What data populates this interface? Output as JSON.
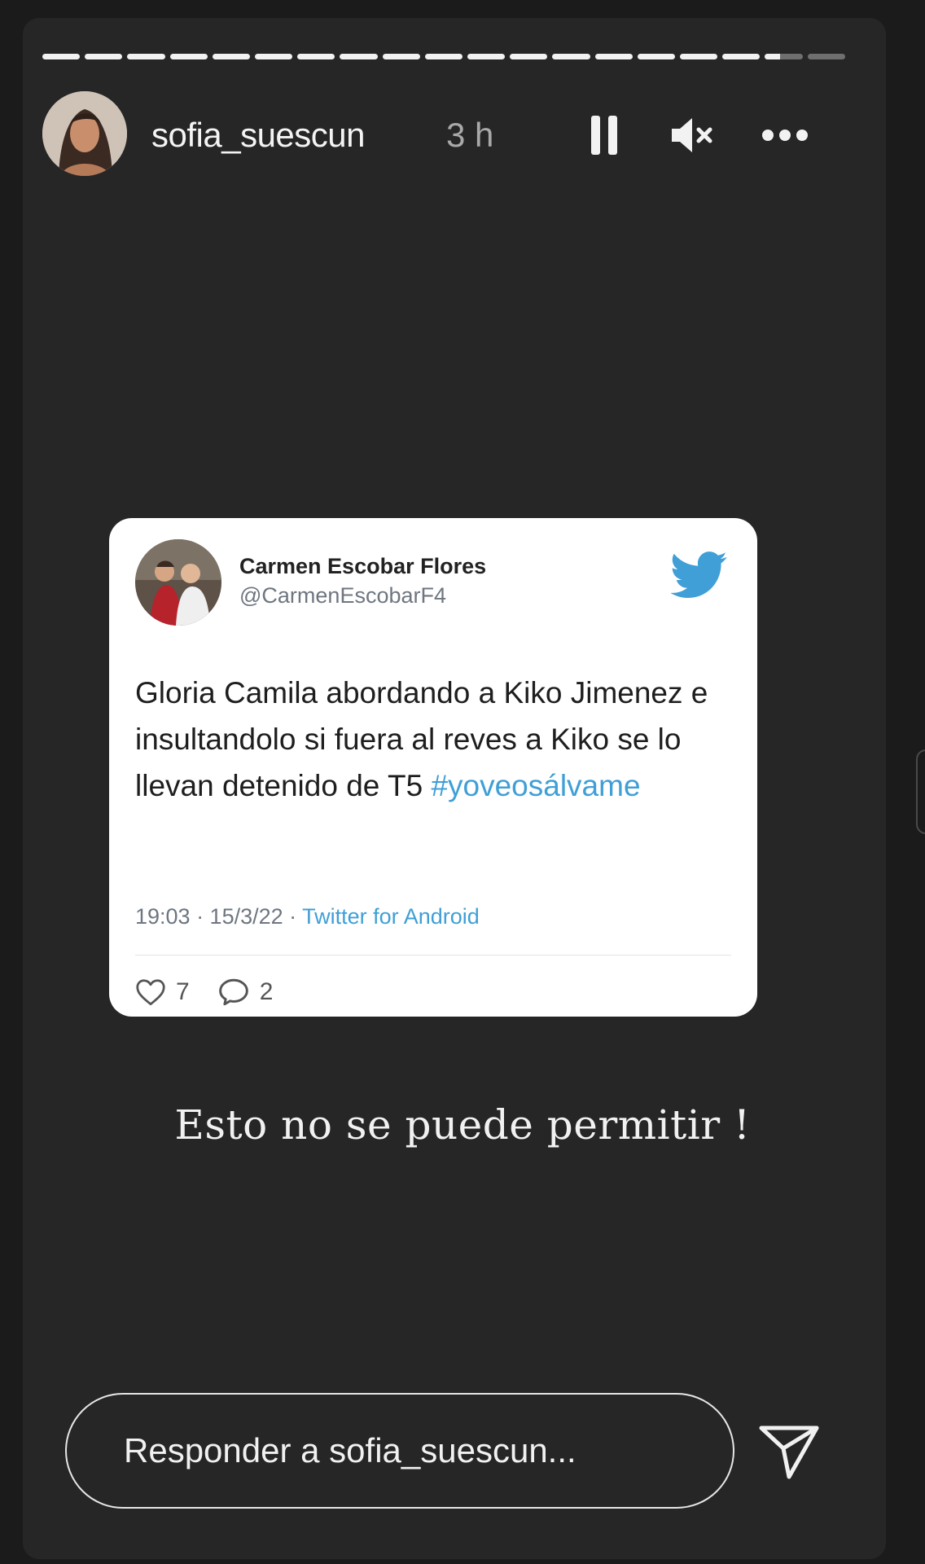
{
  "story": {
    "username": "sofia_suescun",
    "time_ago": "3 h",
    "progress": {
      "segment_count": 19,
      "completed_segments": 17,
      "current_segment_fill": 0.4
    }
  },
  "header_controls": {
    "pause_icon": "pause-icon",
    "mute_icon": "muted-speaker-icon",
    "more_icon": "more-options-icon"
  },
  "tweet": {
    "author_name": "Carmen Escobar Flores",
    "author_handle": "@CarmenEscobarF4",
    "body_text": "Gloria Camila abordando a Kiko Jimenez e insultandolo si fuera al reves a Kiko se lo llevan detenido de T5 ",
    "hashtag": "#yoveosálvame",
    "timestamp": "19:03 · 15/3/22 · ",
    "source": "Twitter for Android",
    "likes": "7",
    "replies": "2",
    "brand_color": "#3f9fd6"
  },
  "caption": "Esto no se puede permitir !",
  "reply": {
    "placeholder": "Responder a sofia_suescun..."
  },
  "colors": {
    "background": "#1b1b1b",
    "panel": "#262626",
    "twitter_blue": "#3f9fd6"
  }
}
